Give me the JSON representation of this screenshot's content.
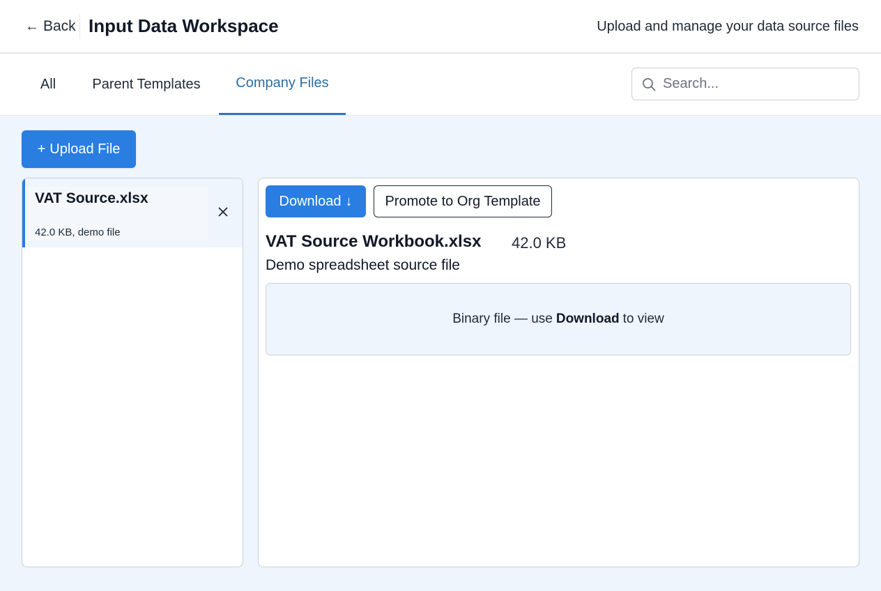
{
  "header": {
    "back_label": "Back",
    "title": "Input Data Workspace",
    "subtitle": "Upload and manage your data source files"
  },
  "tabs": [
    {
      "label": "All",
      "active": false
    },
    {
      "label": "Parent Templates",
      "active": false
    },
    {
      "label": "Company Files",
      "active": true
    }
  ],
  "search": {
    "placeholder": "Search...",
    "value": ""
  },
  "toolbar": {
    "upload_label": "Upload File"
  },
  "file_list": [
    {
      "name": "VAT Source.xlsx",
      "meta": "42.0 KB, demo file",
      "selected": true
    }
  ],
  "detail": {
    "download_label": "Download",
    "promote_label": "Promote to Org Template",
    "file_name": "VAT Source Workbook.xlsx",
    "file_size": "42.0 KB",
    "description": "Demo spreadsheet source file",
    "preview_prefix": "Binary file — use",
    "preview_action": "Download",
    "preview_suffix": "to view"
  },
  "colors": {
    "accent": "#2a7de1",
    "active_tab": "#2a6ea3",
    "workspace_bg": "#eef5fd",
    "border": "#c9d0d9"
  },
  "icons": [
    "back-arrow-icon",
    "search-icon",
    "plus-icon",
    "close-icon",
    "download-arrow-icon"
  ]
}
